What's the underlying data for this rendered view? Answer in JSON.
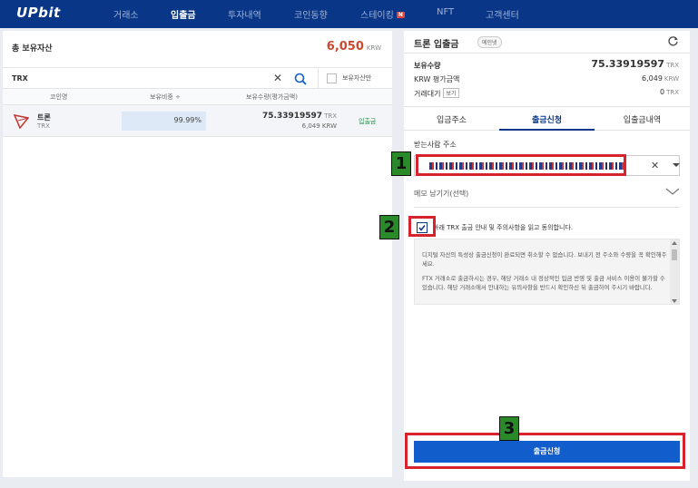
{
  "nav": {
    "logo": "UPbit",
    "items": [
      "거래소",
      "입출금",
      "투자내역",
      "코인동향",
      "스테이킹",
      "NFT",
      "고객센터"
    ],
    "active_index": 1,
    "new_badge": "N"
  },
  "left": {
    "total_label": "총 보유자산",
    "total_value": "6,050",
    "total_unit": "KRW",
    "search_value": "TRX",
    "only_held_label": "보유자산만",
    "columns": [
      "코인명",
      "보유비중 ÷",
      "보유수량(평가금액)"
    ],
    "rows": [
      {
        "name": "트론",
        "symbol": "TRX",
        "percent": "99.99%",
        "amount": "75.33919597",
        "amount_unit": "TRX",
        "krw": "6,049 KRW",
        "action": "입출금"
      }
    ]
  },
  "right": {
    "title": "트론 입출금",
    "badge": "메인넷",
    "held_label": "보유수량",
    "held_value": "75.33919597",
    "held_unit": "TRX",
    "krw_label": "KRW 평가금액",
    "krw_value": "6,049",
    "krw_unit": "KRW",
    "pending_label": "거래대기",
    "pending_btn": "보기",
    "pending_value": "0",
    "pending_unit": "TRX",
    "tabs": [
      "입금주소",
      "출금신청",
      "입출금내역"
    ],
    "active_tab": 1,
    "receiver_label": "받는사람 주소",
    "memo_label": "메모 남기기(선택)",
    "agree_text": "아래 TRX 출금 안내 및 주의사항을 읽고 동의합니다.",
    "notice_paragraphs": [
      "디지털 자산의 특성상 출금신청이 완료되면 취소할 수 없습니다. 보내기 전 주소와 수량을 꼭 확인해주세요.",
      "FTX 거래소로 출금하시는 경우, 해당 거래소 내 정상적인 입금 반영 및 출금 서비스 이용이 불가할 수 있습니다. 해당 거래소에서 안내하는 유의사항을 반드시 확인하신 뒤 출금하여 주시기 바랍니다."
    ],
    "submit_label": "출금신청"
  },
  "markers": [
    "1",
    "2",
    "3"
  ],
  "colors": {
    "nav_bg": "#093687",
    "accent_red": "#c84a31",
    "submit_bg": "#115dcb",
    "marker_red": "#d7232d",
    "marker_green": "#2a8a2a",
    "link_green": "#1a8a43"
  }
}
